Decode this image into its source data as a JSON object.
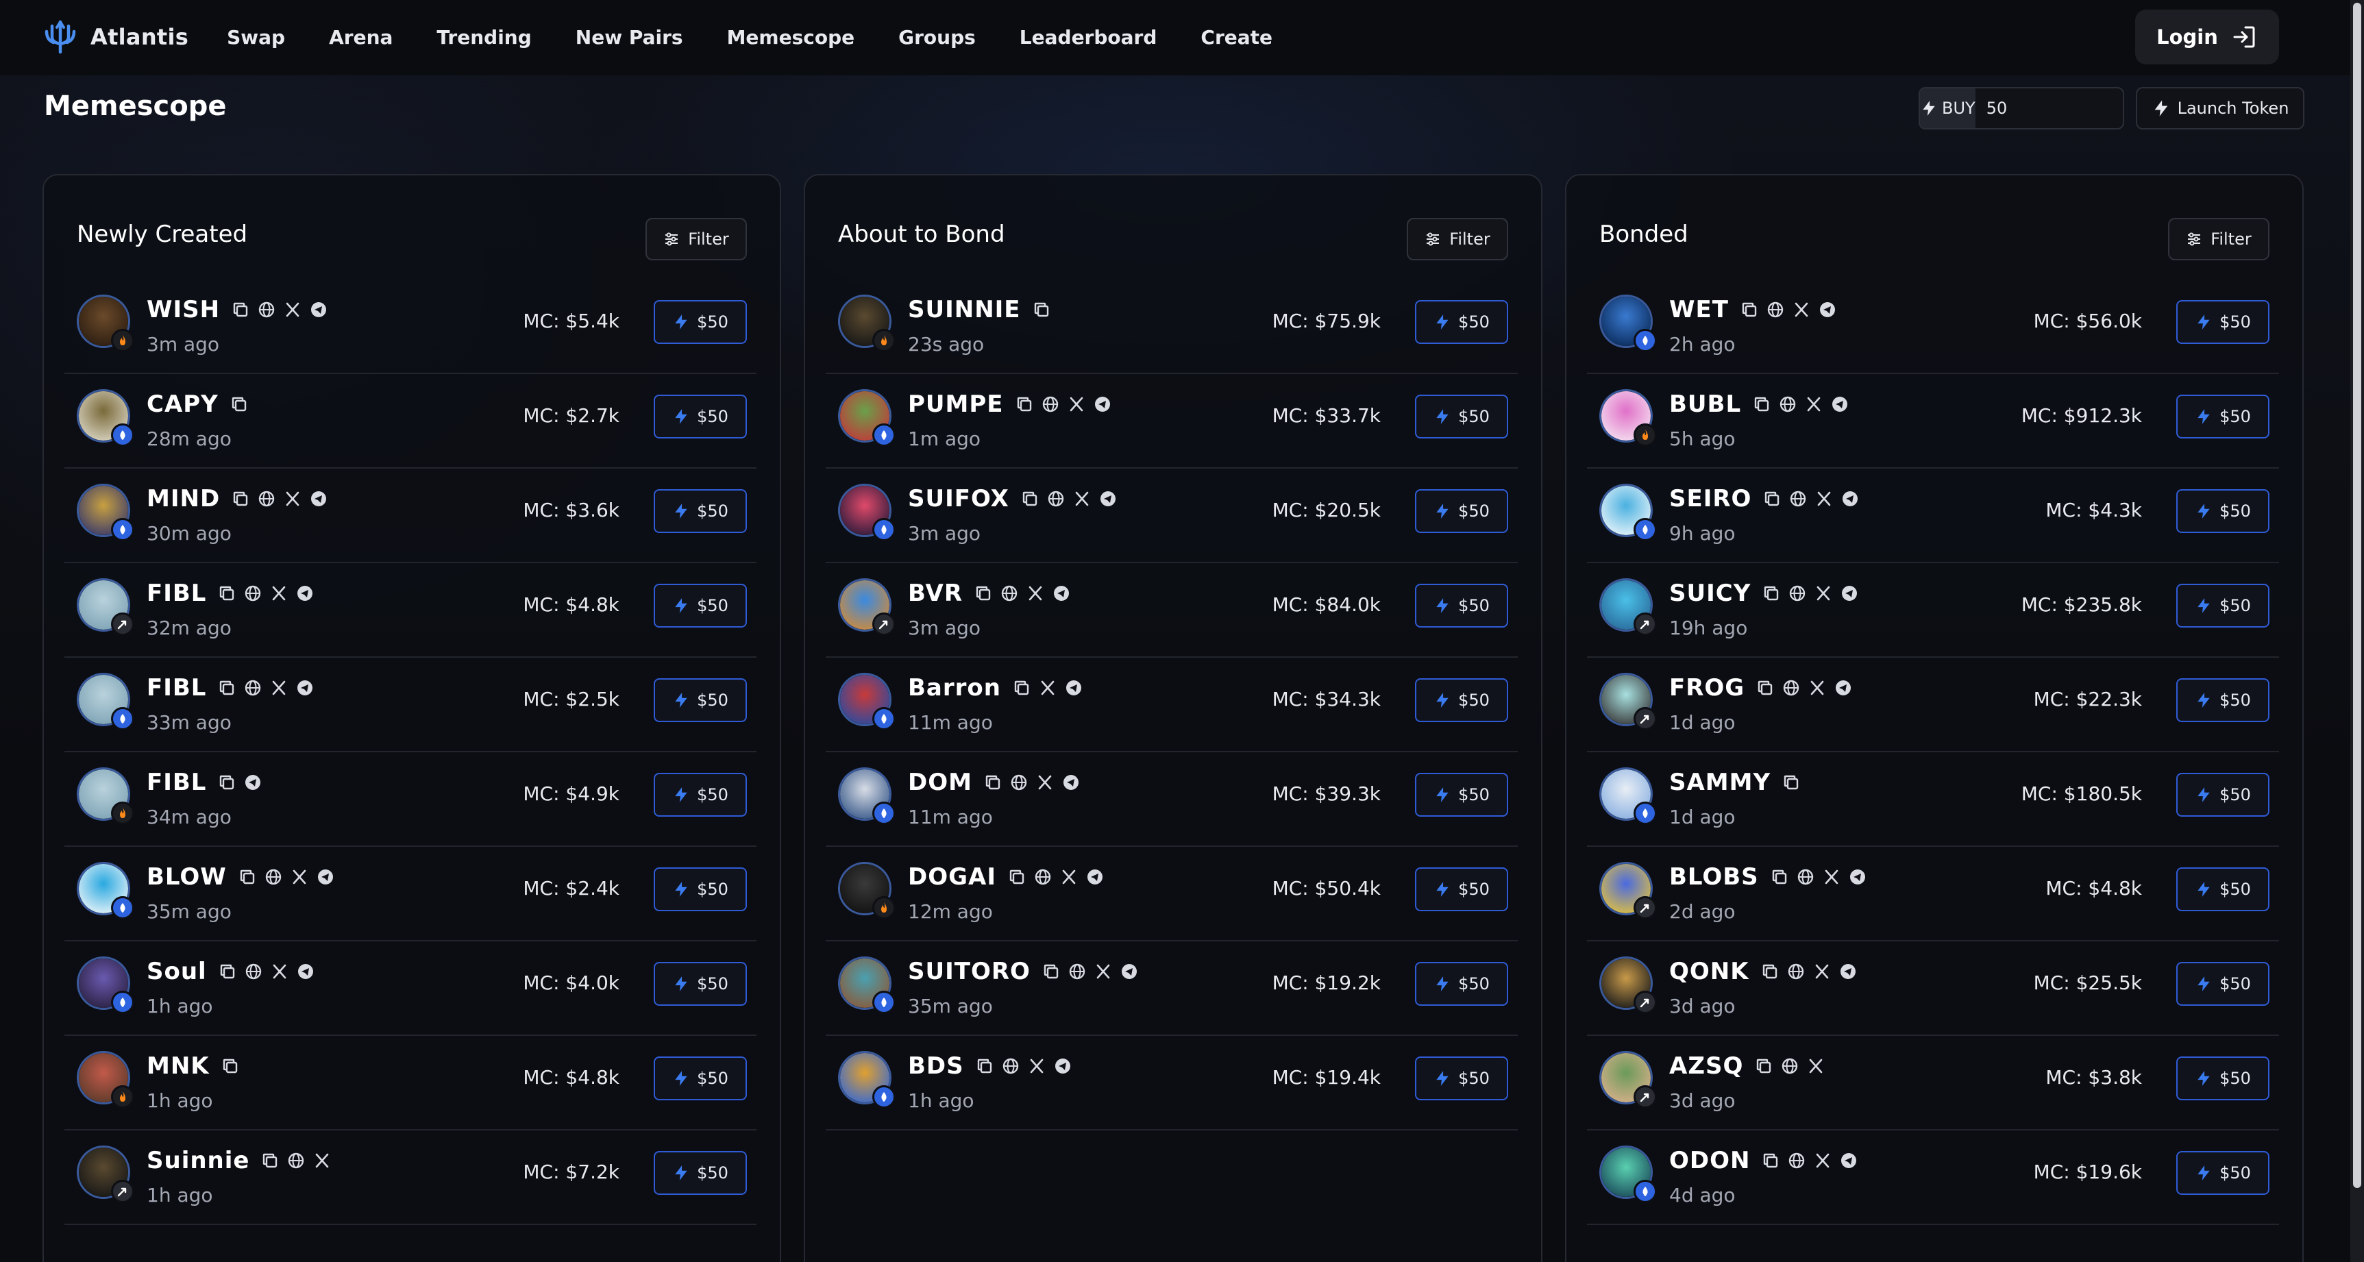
{
  "brand": {
    "name": "Atlantis"
  },
  "nav": [
    "Swap",
    "Arena",
    "Trending",
    "New Pairs",
    "Memescope",
    "Groups",
    "Leaderboard",
    "Create"
  ],
  "login_label": "Login",
  "page_title": "Memescope",
  "buy_label": "BUY",
  "buy_amount": "50",
  "launch_label": "Launch Token",
  "filter_label": "Filter",
  "buy_button_label": "$50",
  "colors": {
    "sui_blue": "#2f64e0",
    "accent_border": "#2f5bd6",
    "fire": "#ff8a1a"
  },
  "columns": [
    {
      "title": "Newly Created",
      "rows": [
        {
          "name": "WISH",
          "age": "3m ago",
          "mc": "MC: $5.4k",
          "icons": [
            "copy",
            "globe",
            "x",
            "telegram"
          ],
          "badge": "fire",
          "avatar": [
            "#6b4a2a",
            "#2a1c10"
          ]
        },
        {
          "name": "CAPY",
          "age": "28m ago",
          "mc": "MC: $2.7k",
          "icons": [
            "copy"
          ],
          "badge": "sui",
          "avatar": [
            "#7a6a3a",
            "#d9d4c2"
          ]
        },
        {
          "name": "MIND",
          "age": "30m ago",
          "mc": "MC: $3.6k",
          "icons": [
            "copy",
            "globe",
            "x",
            "telegram"
          ],
          "badge": "sui",
          "avatar": [
            "#c8a040",
            "#3a3a6a"
          ]
        },
        {
          "name": "FIBL",
          "age": "32m ago",
          "mc": "MC: $4.8k",
          "icons": [
            "copy",
            "globe",
            "x",
            "telegram"
          ],
          "badge": "bolt",
          "avatar": [
            "#b9d2dc",
            "#7ea3b5"
          ]
        },
        {
          "name": "FIBL",
          "age": "33m ago",
          "mc": "MC: $2.5k",
          "icons": [
            "copy",
            "globe",
            "x",
            "telegram"
          ],
          "badge": "sui",
          "avatar": [
            "#b9d2dc",
            "#7ea3b5"
          ]
        },
        {
          "name": "FIBL",
          "age": "34m ago",
          "mc": "MC: $4.9k",
          "icons": [
            "copy",
            "telegram"
          ],
          "badge": "fire",
          "avatar": [
            "#b9d2dc",
            "#7ea3b5"
          ]
        },
        {
          "name": "BLOW",
          "age": "35m ago",
          "mc": "MC: $2.4k",
          "icons": [
            "copy",
            "globe",
            "x",
            "telegram"
          ],
          "badge": "sui",
          "avatar": [
            "#29a8e0",
            "#e9f3f8"
          ]
        },
        {
          "name": "Soul",
          "age": "1h ago",
          "mc": "MC: $4.0k",
          "icons": [
            "copy",
            "globe",
            "x",
            "telegram"
          ],
          "badge": "sui",
          "avatar": [
            "#6a5ab0",
            "#2a2040"
          ]
        },
        {
          "name": "MNK",
          "age": "1h ago",
          "mc": "MC: $4.8k",
          "icons": [
            "copy"
          ],
          "badge": "fire",
          "avatar": [
            "#c25a4a",
            "#5a3a2a"
          ]
        },
        {
          "name": "Suinnie",
          "age": "1h ago",
          "mc": "MC: $7.2k",
          "icons": [
            "copy",
            "globe",
            "x"
          ],
          "badge": "bolt",
          "avatar": [
            "#5a4a30",
            "#151515"
          ]
        }
      ]
    },
    {
      "title": "About to Bond",
      "rows": [
        {
          "name": "SUINNIE",
          "age": "23s ago",
          "mc": "MC: $75.9k",
          "icons": [
            "copy"
          ],
          "badge": "fire",
          "avatar": [
            "#5a4a30",
            "#151515"
          ]
        },
        {
          "name": "PUMPE",
          "age": "1m ago",
          "mc": "MC: $33.7k",
          "icons": [
            "copy",
            "globe",
            "x",
            "telegram"
          ],
          "badge": "sui",
          "avatar": [
            "#6aa04a",
            "#c03a3a"
          ]
        },
        {
          "name": "SUIFOX",
          "age": "3m ago",
          "mc": "MC: $20.5k",
          "icons": [
            "copy",
            "globe",
            "x",
            "telegram"
          ],
          "badge": "sui",
          "avatar": [
            "#e04a6a",
            "#2a1a3a"
          ]
        },
        {
          "name": "BVR",
          "age": "3m ago",
          "mc": "MC: $84.0k",
          "icons": [
            "copy",
            "globe",
            "x",
            "telegram"
          ],
          "badge": "bolt",
          "avatar": [
            "#3a8ae0",
            "#d08a3a"
          ]
        },
        {
          "name": "Barron",
          "age": "11m ago",
          "mc": "MC: $34.3k",
          "icons": [
            "copy",
            "x",
            "telegram"
          ],
          "badge": "sui",
          "avatar": [
            "#c83a3a",
            "#2a4aa0"
          ]
        },
        {
          "name": "DOM",
          "age": "11m ago",
          "mc": "MC: $39.3k",
          "icons": [
            "copy",
            "globe",
            "x",
            "telegram"
          ],
          "badge": "sui",
          "avatar": [
            "#d8dde6",
            "#3a5a8a"
          ]
        },
        {
          "name": "DOGAI",
          "age": "12m ago",
          "mc": "MC: $50.4k",
          "icons": [
            "copy",
            "globe",
            "x",
            "telegram"
          ],
          "badge": "fire",
          "avatar": [
            "#3a3a3a",
            "#111111"
          ]
        },
        {
          "name": "SUITORO",
          "age": "35m ago",
          "mc": "MC: $19.2k",
          "icons": [
            "copy",
            "globe",
            "x",
            "telegram"
          ],
          "badge": "sui",
          "avatar": [
            "#4aa0b0",
            "#8a5a3a"
          ]
        },
        {
          "name": "BDS",
          "age": "1h ago",
          "mc": "MC: $19.4k",
          "icons": [
            "copy",
            "globe",
            "x",
            "telegram"
          ],
          "badge": "sui",
          "avatar": [
            "#e0a030",
            "#3a6ad0"
          ]
        }
      ]
    },
    {
      "title": "Bonded",
      "rows": [
        {
          "name": "WET",
          "age": "2h ago",
          "mc": "MC: $56.0k",
          "icons": [
            "copy",
            "globe",
            "x",
            "telegram"
          ],
          "badge": "sui",
          "avatar": [
            "#3a7ad0",
            "#0a2a5a"
          ]
        },
        {
          "name": "BUBL",
          "age": "5h ago",
          "mc": "MC: $912.3k",
          "icons": [
            "copy",
            "globe",
            "x",
            "telegram"
          ],
          "badge": "fire",
          "avatar": [
            "#e070c8",
            "#f5e0f0"
          ]
        },
        {
          "name": "SEIRO",
          "age": "9h ago",
          "mc": "MC: $4.3k",
          "icons": [
            "copy",
            "globe",
            "x",
            "telegram"
          ],
          "badge": "sui",
          "avatar": [
            "#4ab0e0",
            "#e8f4fa"
          ]
        },
        {
          "name": "SUICY",
          "age": "19h ago",
          "mc": "MC: $235.8k",
          "icons": [
            "copy",
            "globe",
            "x",
            "telegram"
          ],
          "badge": "bolt",
          "avatar": [
            "#4ac0e8",
            "#2a6a9a"
          ]
        },
        {
          "name": "FROG",
          "age": "1d ago",
          "mc": "MC: $22.3k",
          "icons": [
            "copy",
            "globe",
            "x",
            "telegram"
          ],
          "badge": "bolt",
          "avatar": [
            "#a8e0e0",
            "#3a3a3a"
          ]
        },
        {
          "name": "SAMMY",
          "age": "1d ago",
          "mc": "MC: $180.5k",
          "icons": [
            "copy"
          ],
          "badge": "sui",
          "avatar": [
            "#e8eef5",
            "#8ab0e0"
          ]
        },
        {
          "name": "BLOBS",
          "age": "2d ago",
          "mc": "MC: $4.8k",
          "icons": [
            "copy",
            "globe",
            "x",
            "telegram"
          ],
          "badge": "bolt",
          "avatar": [
            "#4a6ae0",
            "#e0c040"
          ]
        },
        {
          "name": "QONK",
          "age": "3d ago",
          "mc": "MC: $25.5k",
          "icons": [
            "copy",
            "globe",
            "x",
            "telegram"
          ],
          "badge": "bolt",
          "avatar": [
            "#c89a4a",
            "#1a1a1a"
          ]
        },
        {
          "name": "AZSQ",
          "age": "3d ago",
          "mc": "MC: $3.8k",
          "icons": [
            "copy",
            "globe",
            "x"
          ],
          "badge": "bolt",
          "avatar": [
            "#6a9a5a",
            "#d8b08a"
          ]
        },
        {
          "name": "ODON",
          "age": "4d ago",
          "mc": "MC: $19.6k",
          "icons": [
            "copy",
            "globe",
            "x",
            "telegram"
          ],
          "badge": "sui",
          "avatar": [
            "#5ad0b0",
            "#1a4a5a"
          ]
        }
      ]
    }
  ]
}
